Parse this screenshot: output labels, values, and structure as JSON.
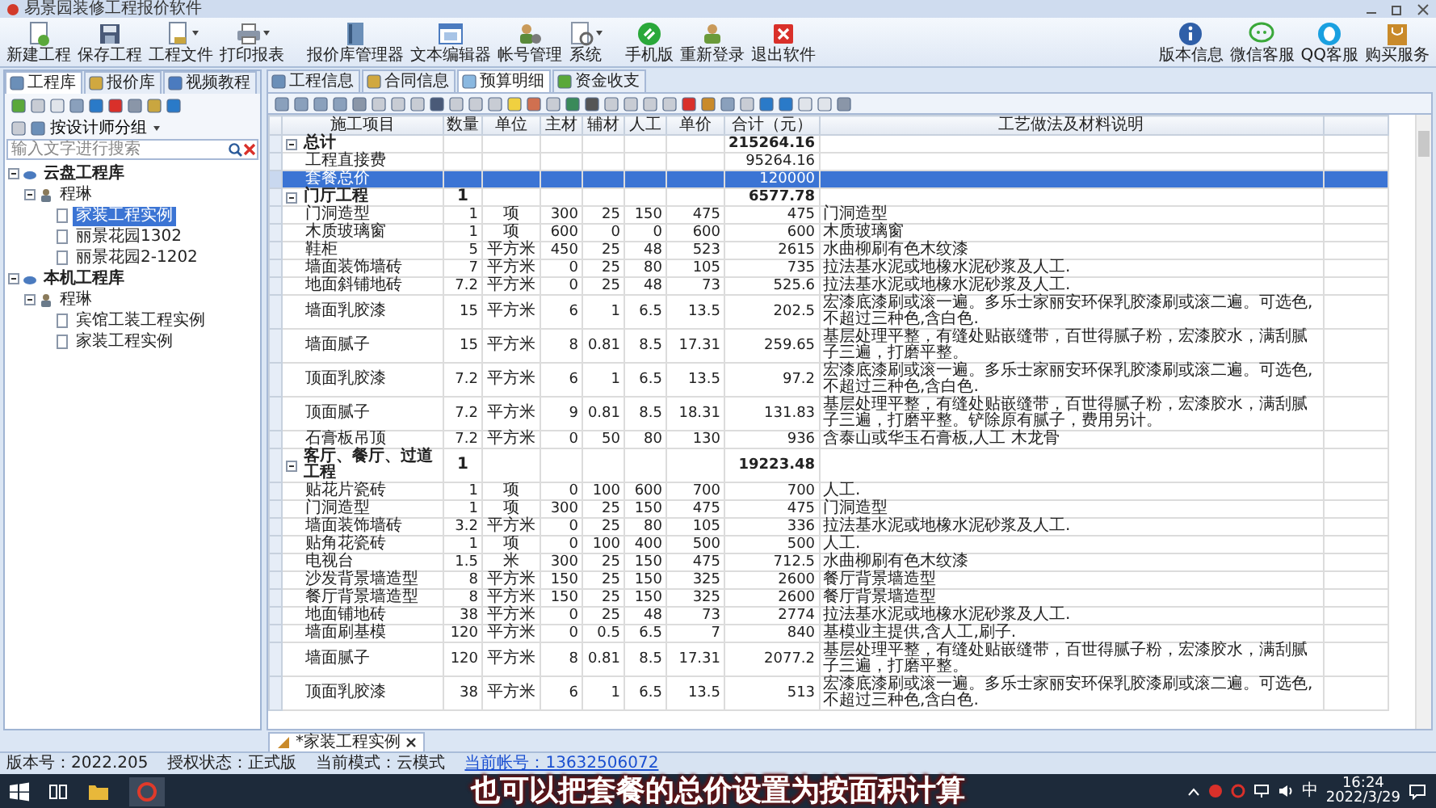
{
  "window": {
    "title": "易景园装修工程报价软件"
  },
  "ribbon": {
    "buttons": [
      {
        "label": "新建工程",
        "dropdown": false
      },
      {
        "label": "保存工程",
        "dropdown": false
      },
      {
        "label": "工程文件",
        "dropdown": true
      },
      {
        "label": "打印报表",
        "dropdown": true
      },
      {
        "label": "报价库管理器",
        "dropdown": false
      },
      {
        "label": "文本编辑器",
        "dropdown": false
      },
      {
        "label": "帐号管理",
        "dropdown": false
      },
      {
        "label": "系统",
        "dropdown": true
      },
      {
        "label": "手机版",
        "dropdown": false
      },
      {
        "label": "重新登录",
        "dropdown": false
      },
      {
        "label": "退出软件",
        "dropdown": false
      }
    ],
    "right_buttons": [
      {
        "label": "版本信息"
      },
      {
        "label": "微信客服"
      },
      {
        "label": "QQ客服"
      },
      {
        "label": "购买服务"
      }
    ]
  },
  "left_panel": {
    "tabs": [
      {
        "label": "工程库",
        "selected": true
      },
      {
        "label": "报价库",
        "selected": false
      },
      {
        "label": "视频教程",
        "selected": false
      }
    ],
    "group_by": "按设计师分组",
    "search": {
      "placeholder": "输入文字进行搜索"
    },
    "tree": [
      {
        "label": "云盘工程库",
        "selected": false,
        "expanded": true,
        "children": [
          {
            "label": "程琳",
            "selected": false,
            "expanded": true,
            "children": [
              {
                "label": "家装工程实例",
                "selected": true
              },
              {
                "label": "丽景花园1302",
                "selected": false
              },
              {
                "label": "丽景花园2-1202",
                "selected": false
              }
            ]
          }
        ]
      },
      {
        "label": "本机工程库",
        "selected": false,
        "expanded": true,
        "children": [
          {
            "label": "程琳",
            "selected": false,
            "expanded": true,
            "children": [
              {
                "label": "宾馆工装工程实例",
                "selected": false
              },
              {
                "label": "家装工程实例",
                "selected": false
              }
            ]
          }
        ]
      }
    ]
  },
  "main_tabs": [
    {
      "label": "工程信息",
      "selected": false
    },
    {
      "label": "合同信息",
      "selected": false
    },
    {
      "label": "预算明细",
      "selected": true
    },
    {
      "label": "资金收支",
      "selected": false
    }
  ],
  "table": {
    "columns": [
      "施工项目",
      "数量",
      "单位",
      "主材",
      "辅材",
      "人工",
      "单价",
      "合计（元）",
      "工艺做法及材料说明"
    ],
    "rows": [
      {
        "item": "总计",
        "total": "215264.16",
        "selected": false,
        "expanded": true,
        "children": [
          {
            "item": "工程直接费",
            "total": "95264.16",
            "selected": false
          },
          {
            "item": "套餐总价",
            "total": "120000",
            "selected": true
          }
        ]
      },
      {
        "item": "门厅工程",
        "quantity": "1",
        "total": "6577.78",
        "selected": false,
        "expanded": true,
        "children": [
          {
            "item": "门洞造型",
            "quantity": "1",
            "unit": "项",
            "main_material": "300",
            "auxiliary_material": "25",
            "labor": "150",
            "unit_price": "475",
            "total": "475",
            "notes": "门洞造型",
            "selected": false
          },
          {
            "item": "木质玻璃窗",
            "quantity": "1",
            "unit": "项",
            "main_material": "600",
            "auxiliary_material": "0",
            "labor": "0",
            "unit_price": "600",
            "total": "600",
            "notes": "木质玻璃窗",
            "selected": false
          },
          {
            "item": "鞋柜",
            "quantity": "5",
            "unit": "平方米",
            "main_material": "450",
            "auxiliary_material": "25",
            "labor": "48",
            "unit_price": "523",
            "total": "2615",
            "notes": "水曲柳刷有色木纹漆",
            "selected": false
          },
          {
            "item": "墙面装饰墙砖",
            "quantity": "7",
            "unit": "平方米",
            "main_material": "0",
            "auxiliary_material": "25",
            "labor": "80",
            "unit_price": "105",
            "total": "735",
            "notes": "拉法基水泥或地橡水泥砂浆及人工.",
            "selected": false
          },
          {
            "item": "地面斜铺地砖",
            "quantity": "7.2",
            "unit": "平方米",
            "main_material": "0",
            "auxiliary_material": "25",
            "labor": "48",
            "unit_price": "73",
            "total": "525.6",
            "notes": "拉法基水泥或地橡水泥砂浆及人工.",
            "selected": false
          },
          {
            "item": "墙面乳胶漆",
            "quantity": "15",
            "unit": "平方米",
            "main_material": "6",
            "auxiliary_material": "1",
            "labor": "6.5",
            "unit_price": "13.5",
            "total": "202.5",
            "notes": "宏漆底漆刷或滚一遍。多乐士家丽安环保乳胶漆刷或滚二遍。可选色,不超过三种色,含白色.",
            "selected": false
          },
          {
            "item": "墙面腻子",
            "quantity": "15",
            "unit": "平方米",
            "main_material": "8",
            "auxiliary_material": "0.81",
            "labor": "8.5",
            "unit_price": "17.31",
            "total": "259.65",
            "notes": "基层处理平整，有缝处贴嵌缝带，百世得腻子粉，宏漆胶水，满刮腻子三遍，打磨平整。",
            "selected": false
          },
          {
            "item": "顶面乳胶漆",
            "quantity": "7.2",
            "unit": "平方米",
            "main_material": "6",
            "auxiliary_material": "1",
            "labor": "6.5",
            "unit_price": "13.5",
            "total": "97.2",
            "notes": "宏漆底漆刷或滚一遍。多乐士家丽安环保乳胶漆刷或滚二遍。可选色,不超过三种色,含白色.",
            "selected": false
          },
          {
            "item": "顶面腻子",
            "quantity": "7.2",
            "unit": "平方米",
            "main_material": "9",
            "auxiliary_material": "0.81",
            "labor": "8.5",
            "unit_price": "18.31",
            "total": "131.83",
            "notes": "基层处理平整，有缝处贴嵌缝带，百世得腻子粉，宏漆胶水，满刮腻子三遍，打磨平整。铲除原有腻子，费用另计。",
            "selected": false
          },
          {
            "item": "石膏板吊顶",
            "quantity": "7.2",
            "unit": "平方米",
            "main_material": "0",
            "auxiliary_material": "50",
            "labor": "80",
            "unit_price": "130",
            "total": "936",
            "notes": "含泰山或华玉石膏板,人工 木龙骨",
            "selected": false
          }
        ]
      },
      {
        "item": "客厅、餐厅、过道工程",
        "quantity": "1",
        "total": "19223.48",
        "selected": false,
        "expanded": true,
        "children": [
          {
            "item": "贴花片瓷砖",
            "quantity": "1",
            "unit": "项",
            "main_material": "0",
            "auxiliary_material": "100",
            "labor": "600",
            "unit_price": "700",
            "total": "700",
            "notes": "人工.",
            "selected": false
          },
          {
            "item": "门洞造型",
            "quantity": "1",
            "unit": "项",
            "main_material": "300",
            "auxiliary_material": "25",
            "labor": "150",
            "unit_price": "475",
            "total": "475",
            "notes": "门洞造型",
            "selected": false
          },
          {
            "item": "墙面装饰墙砖",
            "quantity": "3.2",
            "unit": "平方米",
            "main_material": "0",
            "auxiliary_material": "25",
            "labor": "80",
            "unit_price": "105",
            "total": "336",
            "notes": "拉法基水泥或地橡水泥砂浆及人工.",
            "selected": false
          },
          {
            "item": "贴角花瓷砖",
            "quantity": "1",
            "unit": "项",
            "main_material": "0",
            "auxiliary_material": "100",
            "labor": "400",
            "unit_price": "500",
            "total": "500",
            "notes": "人工.",
            "selected": false
          },
          {
            "item": "电视台",
            "quantity": "1.5",
            "unit": "米",
            "main_material": "300",
            "auxiliary_material": "25",
            "labor": "150",
            "unit_price": "475",
            "total": "712.5",
            "notes": "水曲柳刷有色木纹漆",
            "selected": false
          },
          {
            "item": "沙发背景墙造型",
            "quantity": "8",
            "unit": "平方米",
            "main_material": "150",
            "auxiliary_material": "25",
            "labor": "150",
            "unit_price": "325",
            "total": "2600",
            "notes": "餐厅背景墙造型",
            "selected": false
          },
          {
            "item": "餐厅背景墙造型",
            "quantity": "8",
            "unit": "平方米",
            "main_material": "150",
            "auxiliary_material": "25",
            "labor": "150",
            "unit_price": "325",
            "total": "2600",
            "notes": "餐厅背景墙造型",
            "selected": false
          },
          {
            "item": "地面铺地砖",
            "quantity": "38",
            "unit": "平方米",
            "main_material": "0",
            "auxiliary_material": "25",
            "labor": "48",
            "unit_price": "73",
            "total": "2774",
            "notes": "拉法基水泥或地橡水泥砂浆及人工.",
            "selected": false
          },
          {
            "item": "墙面刷基模",
            "quantity": "120",
            "unit": "平方米",
            "main_material": "0",
            "auxiliary_material": "0.5",
            "labor": "6.5",
            "unit_price": "7",
            "total": "840",
            "notes": "基模业主提供,含人工,刷子.",
            "selected": false
          },
          {
            "item": "墙面腻子",
            "quantity": "120",
            "unit": "平方米",
            "main_material": "8",
            "auxiliary_material": "0.81",
            "labor": "8.5",
            "unit_price": "17.31",
            "total": "2077.2",
            "notes": "基层处理平整，有缝处贴嵌缝带，百世得腻子粉，宏漆胶水，满刮腻子三遍，打磨平整。",
            "selected": false
          },
          {
            "item": "顶面乳胶漆",
            "quantity": "38",
            "unit": "平方米",
            "main_material": "6",
            "auxiliary_material": "1",
            "labor": "6.5",
            "unit_price": "13.5",
            "total": "513",
            "notes": "宏漆底漆刷或滚一遍。多乐士家丽安环保乳胶漆刷或滚二遍。可选色,不超过三种色,含白色.",
            "selected": false
          }
        ]
      }
    ]
  },
  "document_tabs": [
    {
      "label": "*家装工程实例",
      "selected": true
    }
  ],
  "status_bar": [
    {
      "label": "版本号：2022.205",
      "link": false
    },
    {
      "label": "授权状态：正式版",
      "link": false
    },
    {
      "label": "当前模式：云模式",
      "link": false
    },
    {
      "label": "当前帐号：13632506072",
      "link": true
    }
  ],
  "taskbar": {
    "input_method": "中",
    "time": "16:24",
    "date": "2022/3/29"
  },
  "caption": "也可以把套餐的总价设置为按面积计算"
}
